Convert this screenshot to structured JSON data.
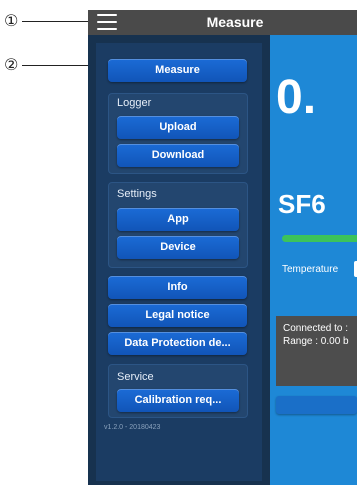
{
  "callouts": {
    "one": "①",
    "two": "②"
  },
  "topbar": {
    "title": "Measure"
  },
  "drawer": {
    "measure_label": "Measure",
    "logger": {
      "label": "Logger",
      "upload_label": "Upload",
      "download_label": "Download"
    },
    "settings": {
      "label": "Settings",
      "app_label": "App",
      "device_label": "Device"
    },
    "info_label": "Info",
    "legal_label": "Legal notice",
    "data_protection_label": "Data Protection de...",
    "service": {
      "label": "Service",
      "calibration_label": "Calibration req..."
    },
    "version": "v1.2.0 - 20180423"
  },
  "main": {
    "value": "0.",
    "gas": "SF6",
    "temperature_label": "Temperature",
    "connected_text": "Connected to :",
    "range_text": "Range : 0.00 b"
  },
  "colors": {
    "topbar": "#4a4a4a",
    "drawer": "#17324f",
    "button": "#1b6bd6",
    "main": "#1e88d6",
    "status": "#3cc35a"
  }
}
